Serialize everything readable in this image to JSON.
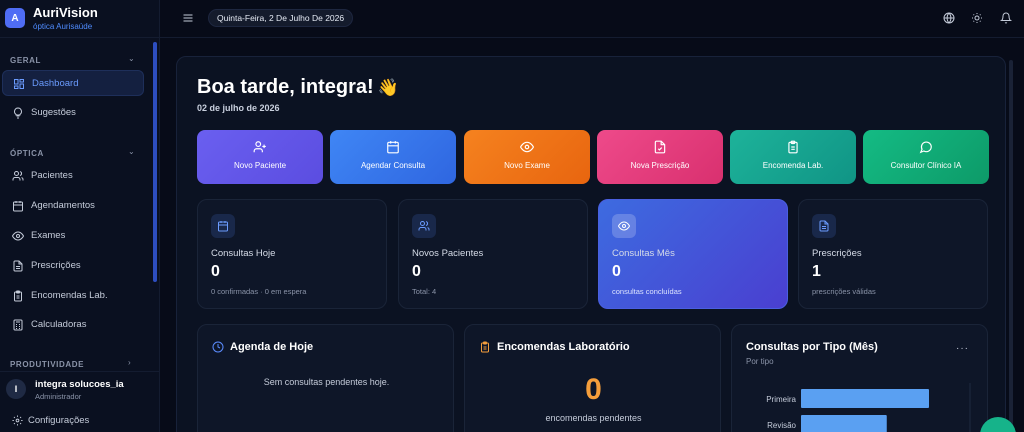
{
  "brand": {
    "logo": "A",
    "title": "AuriVision",
    "subtitle": "óptica Aurisaúde"
  },
  "sidebar": {
    "sections": [
      {
        "label": "GERAL",
        "chevron": "⌄"
      },
      {
        "label": "ÓPTICA",
        "chevron": "⌄"
      },
      {
        "label": "PRODUTIVIDADE",
        "chevron": "›"
      }
    ],
    "items": [
      {
        "label": "Dashboard",
        "icon": "dashboard-icon",
        "active": true
      },
      {
        "label": "Sugestões",
        "icon": "lightbulb-icon"
      },
      {
        "label": "Pacientes",
        "icon": "users-icon"
      },
      {
        "label": "Agendamentos",
        "icon": "calendar-icon"
      },
      {
        "label": "Exames",
        "icon": "eye-icon"
      },
      {
        "label": "Prescrições",
        "icon": "document-icon"
      },
      {
        "label": "Encomendas Lab.",
        "icon": "clipboard-icon"
      },
      {
        "label": "Calculadoras",
        "icon": "calculator-icon"
      }
    ]
  },
  "user": {
    "initial": "I",
    "name": "integra solucoes_ia",
    "role": "Administrador"
  },
  "settings": {
    "label": "Configurações"
  },
  "topbar": {
    "date": "Quinta-Feira, 2 De Julho De 2026"
  },
  "greeting": {
    "title": "Boa tarde, integra!",
    "emoji": "👋",
    "date": "02 de julho de 2026"
  },
  "quick_actions": [
    {
      "label": "Novo Paciente",
      "icon": "user-plus-icon",
      "color": "#6a5ff0"
    },
    {
      "label": "Agendar Consulta",
      "icon": "calendar-icon",
      "color": "#3f7bf2"
    },
    {
      "label": "Novo Exame",
      "icon": "eye-icon",
      "color": "#f07a1e"
    },
    {
      "label": "Nova Prescrição",
      "icon": "file-check-icon",
      "color": "#e8437f"
    },
    {
      "label": "Encomenda Lab.",
      "icon": "clipboard-icon",
      "color": "#18a78e"
    },
    {
      "label": "Consultor Clínico IA",
      "icon": "chat-icon",
      "color": "#10b07a"
    }
  ],
  "stats": [
    {
      "title": "Consultas Hoje",
      "value": "0",
      "sub": "0 confirmadas · 0 em espera",
      "icon": "calendar-icon"
    },
    {
      "title": "Novos Pacientes",
      "value": "0",
      "sub": "Total: 4",
      "icon": "users-icon"
    },
    {
      "title": "Consultas Mês",
      "value": "0",
      "sub": "consultas concluídas",
      "icon": "eye-icon",
      "highlight": true
    },
    {
      "title": "Prescrições",
      "value": "1",
      "sub": "prescrições válidas",
      "icon": "document-icon"
    }
  ],
  "agenda": {
    "title": "Agenda de Hoje",
    "empty": "Sem consultas pendentes hoje."
  },
  "lab_orders": {
    "title": "Encomendas Laboratório",
    "value": "0",
    "sub": "encomendas pendentes"
  },
  "consult_chart": {
    "title": "Consultas por Tipo (Mês)",
    "subtitle": "Por tipo",
    "more": "···"
  },
  "chart_data": {
    "type": "bar",
    "orientation": "horizontal",
    "title": "Consultas por Tipo (Mês)",
    "subtitle": "Por tipo",
    "categories": [
      "Primeira",
      "Revisão"
    ],
    "values": [
      1,
      0.67
    ],
    "bar_color": "#5aa0f2",
    "grid": true
  }
}
